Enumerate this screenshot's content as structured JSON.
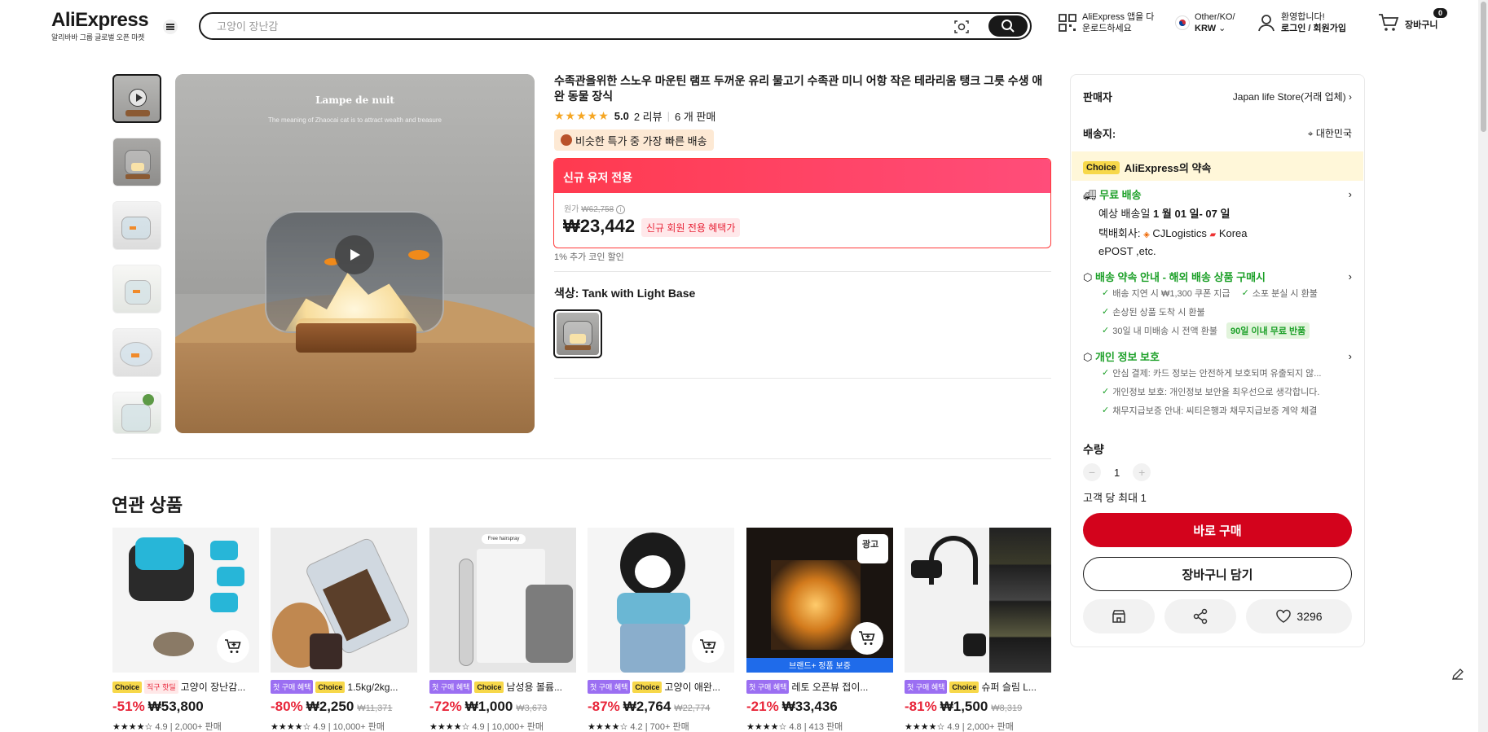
{
  "header": {
    "logo": "AliExpress",
    "logo_sub": "알리바바 그룹 글로벌 오픈 마켓",
    "search_placeholder": "고양이 장난감",
    "app_line1": "AliExpress 앱을 다",
    "app_line2": "운로드하세요",
    "region_line1": "Other/KO/",
    "region_line2": "KRW",
    "account_line1": "환영합니다!",
    "account_line2": "로그인 / 회원가입",
    "cart_count": "0",
    "cart_label": "장바구니"
  },
  "product": {
    "title": "수족관을위한 스노우 마운틴 램프 두꺼운 유리 물고기 수족관 미니 어항 작은 테라리움 탱크 그릇 수생 애완 동물 장식",
    "stars": "★★★★★",
    "rating": "5.0",
    "reviews": "2 리뷰",
    "sold": "6 개 판매",
    "fast_badge": "비슷한 특가 중 가장 빠른 배송",
    "promo_head": "신규 유저 전용",
    "orig_label": "원가",
    "orig_price": "₩62,758",
    "price": "₩23,442",
    "promo_tag": "신규 회원 전용 혜택가",
    "coin": "1% 추가 코인 할인",
    "color_label": "색상: Tank with Light Base",
    "image_title": "Lampe de nuit",
    "image_sub": "The meaning of Zhaocai cat is to attract wealth and treasure"
  },
  "panel": {
    "seller_label": "판매자",
    "seller_name": "Japan life Store(거래 업체)",
    "ship_label": "배송지:",
    "ship_to": "대한민국",
    "choice_tag": "Choice",
    "promise": "AliExpress의 약속",
    "free_ship": "무료 배송",
    "eta_label": "예상 배송일",
    "eta": "1 월 01 일- 07 일",
    "carrier_label": "택배회사:",
    "carrier1": "CJLogistics",
    "carrier2": "Korea",
    "carrier3": "ePOST ,etc.",
    "guarantee": "배송 약속 안내 - 해외 배송 상품 구매시",
    "g1": "배송 지연 시 ₩1,300 쿠폰 지급",
    "g2": "소포 분실 시 환불",
    "g3": "손상된 상품 도착 시 환불",
    "g4": "30일 내 미배송 시 전액 환불",
    "g4_chip": "90일 이내 무료 반품",
    "privacy": "개인 정보 보호",
    "p1": "안심 결제: 카드 정보는 안전하게 보호되며 유출되지 않...",
    "p2": "개인정보 보호: 개인정보 보안을 최우선으로 생각합니다.",
    "p3": "채무지급보증 안내: 씨티은행과 채무지급보증 계약 체결",
    "qty_label": "수량",
    "qty": "1",
    "qty_limit": "고객 당 최대 1",
    "buy_now": "바로 구매",
    "add_cart": "장바구니 담기",
    "wish_count": "3296"
  },
  "related": {
    "title": "연관 상품",
    "items": [
      {
        "tag1": "Choice",
        "tag2": "직구 핫딜",
        "name": "고양이 장난감...",
        "disc": "-51%",
        "price": "₩53,800",
        "orig": "",
        "stars": "★★★★☆",
        "rating": "4.9",
        "sold": "2,000+ 판매"
      },
      {
        "tag1": "첫 구매 혜택",
        "tag2": "Choice",
        "name": "1.5kg/2kg...",
        "disc": "-80%",
        "price": "₩2,250",
        "orig": "₩11,371",
        "stars": "★★★★☆",
        "rating": "4.9",
        "sold": "10,000+ 판매"
      },
      {
        "tag1": "첫 구매 혜택",
        "tag2": "Choice",
        "name": "남성용 볼륨...",
        "disc": "-72%",
        "price": "₩1,000",
        "orig": "₩3,673",
        "stars": "★★★★☆",
        "rating": "4.9",
        "sold": "10,000+ 판매"
      },
      {
        "tag1": "첫 구매 혜택",
        "tag2": "Choice",
        "name": "고양이 애완...",
        "disc": "-87%",
        "price": "₩2,764",
        "orig": "₩22,774",
        "stars": "★★★★☆",
        "rating": "4.2",
        "sold": "700+ 판매"
      },
      {
        "tag1": "첫 구매 혜택",
        "tag2": "",
        "name": "레토 오픈뷰 접이...",
        "disc": "-21%",
        "price": "₩33,436",
        "orig": "",
        "stars": "★★★★☆",
        "rating": "4.8",
        "sold": "413 판매",
        "ad": "광고",
        "brand": "브랜드+ 정품 보증"
      },
      {
        "tag1": "첫 구매 혜택",
        "tag2": "Choice",
        "name": "슈퍼 슬림 L...",
        "disc": "-81%",
        "price": "₩1,500",
        "orig": "₩8,319",
        "stars": "★★★★☆",
        "rating": "4.9",
        "sold": "2,000+ 판매"
      }
    ]
  }
}
